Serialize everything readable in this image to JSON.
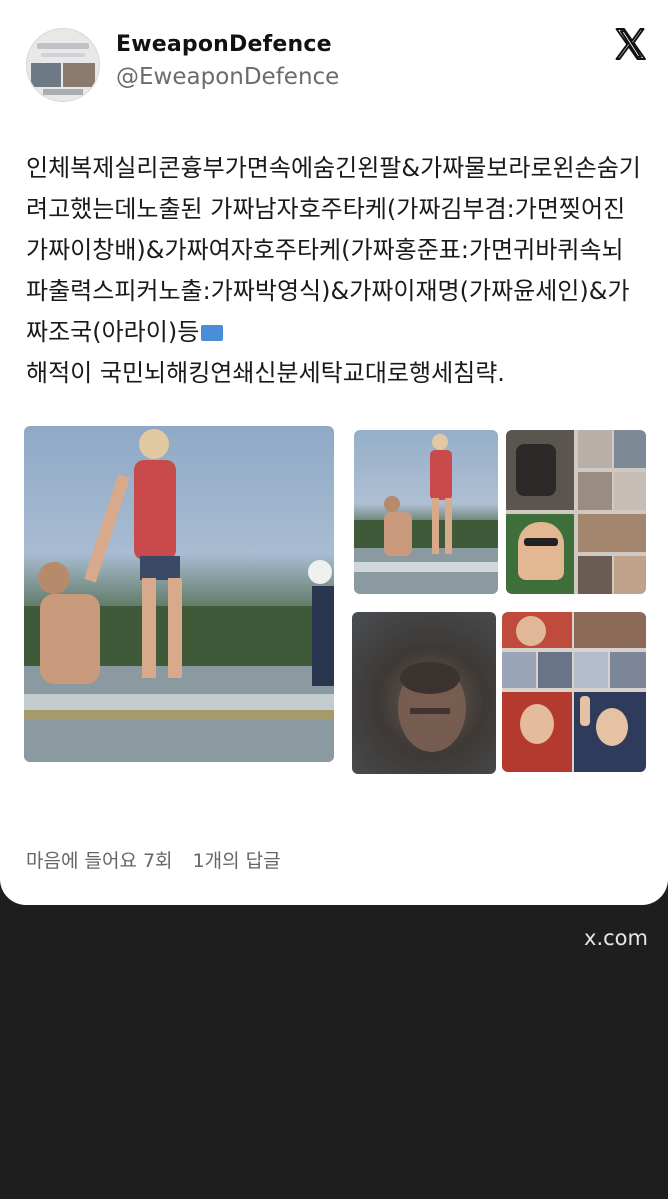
{
  "author": {
    "display_name": "EweaponDefence",
    "handle": "@EweaponDefence"
  },
  "icons": {
    "avatar": "avatar-image",
    "brand": "x-logo-icon",
    "flag": "somalia-flag-emoji"
  },
  "tweet": {
    "text_before_flag": "인체복제실리콘흉부가면속에숨긴왼팔&가짜물보라로왼손숨기려고했는데노출된 가짜남자호주타케(가짜김부겸:가면찢어진가짜이창배)&가짜여자호주타케(가짜홍준표:가면귀바퀴속뇌파출력스피커노출:가짜박영식)&가짜이재명(가짜윤세인)&가짜조국(아라이)등",
    "text_after_flag": "해적이 국민뇌해킹연쇄신분세탁교대로행세침략."
  },
  "stats": {
    "likes": "마음에 들어요 7회",
    "replies": "1개의 답글"
  },
  "source": "x.com",
  "colors": {
    "card": "#ffffff",
    "background": "#1e1e1e",
    "muted_text": "#666666"
  }
}
